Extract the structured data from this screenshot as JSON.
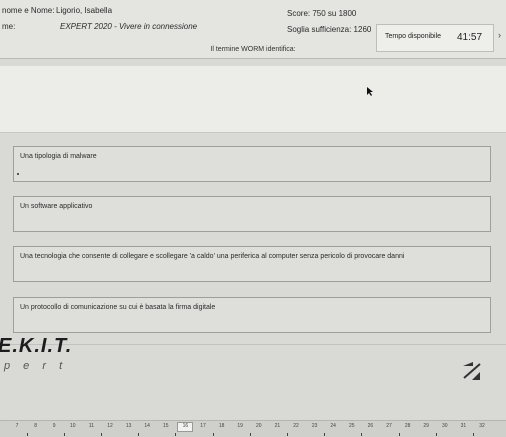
{
  "header": {
    "name_label": "nome e Nome:",
    "name_value": "Ligorio, Isabella",
    "exam_label": "me:",
    "exam_value": "EXPERT 2020 - Vivere in connessione",
    "score": "Score: 750 su 1800",
    "threshold": "Soglia sufficienza: 1260",
    "time_label": "Tempo disponibile",
    "time_value": "41:57"
  },
  "question": "Il termine WORM identifica:",
  "answers": [
    "Una tipologia di malware",
    "Un software applicativo",
    "Una tecnologia che consente di collegare e scollegare 'a caldo' una periferica al computer senza pericolo di provocare danni",
    "Un protocollo di comunicazione su cui è basata la firma digitale"
  ],
  "logo": {
    "main": "E.K.I.T.",
    "sub": "p e r t"
  },
  "pager": [
    "7",
    "8",
    "9",
    "10",
    "11",
    "12",
    "13",
    "14",
    "15",
    "16",
    "17",
    "18",
    "19",
    "20",
    "21",
    "22",
    "23",
    "24",
    "25",
    "26",
    "27",
    "28",
    "29",
    "30",
    "31",
    "32"
  ],
  "pager_active": "16",
  "icons": {
    "cursor": "cursor-icon",
    "next": "next-arrow-icon"
  }
}
